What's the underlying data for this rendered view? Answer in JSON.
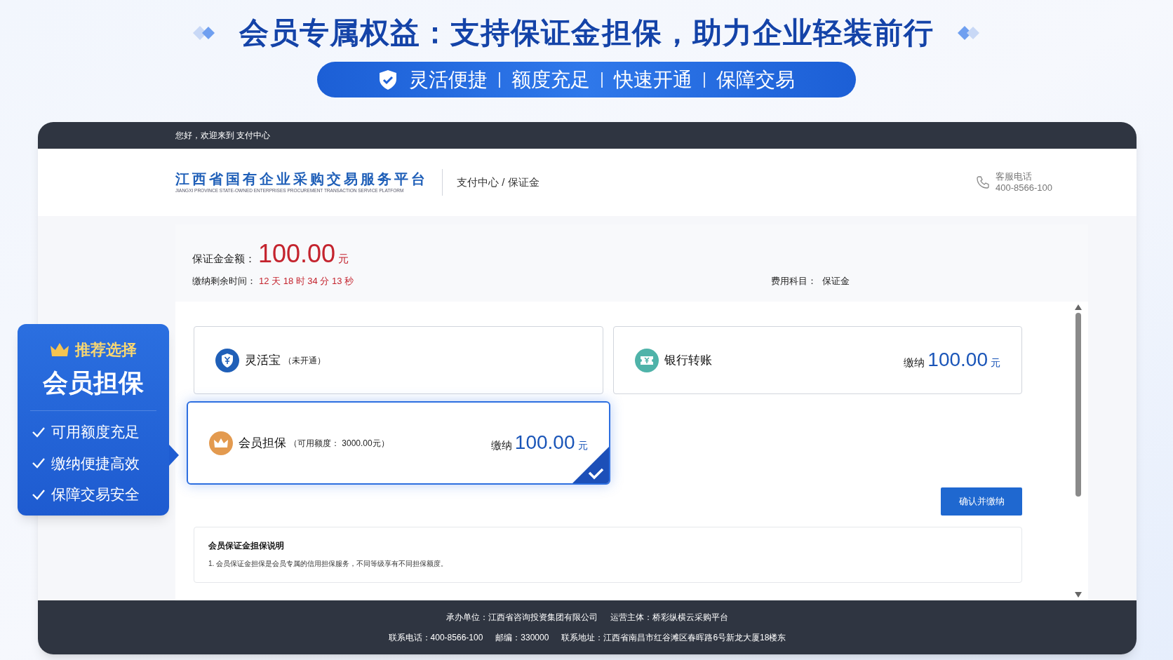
{
  "headline": "会员专属权益：支持保证金担保，助力企业轻装前行",
  "features": [
    "灵活便捷",
    "额度充足",
    "快速开通",
    "保障交易"
  ],
  "window": {
    "greeting": "您好，欢迎来到 支付中心",
    "platform_name": "江西省国有企业采购交易服务平台",
    "platform_english": "JIANGXI PROVINCE STATE-OWNED ENTERPRISES PROCUREMENT TRANSACTION SERVICE PLATFORM",
    "breadcrumb": "支付中心 / 保证金",
    "hotline_label": "客服电话",
    "hotline_number": "400-8566-100"
  },
  "payment": {
    "amount_label": "保证金金额：",
    "amount": "100.00",
    "unit": "元",
    "countdown_label": "缴纳剩余时间：",
    "countdown": "12 天 18 时 34 分 13 秒",
    "fee_label": "费用科目：",
    "fee_value": "保证金"
  },
  "options": [
    {
      "kind": "shield",
      "name": "灵活宝",
      "note": "（未开通）",
      "selected": false
    },
    {
      "kind": "ticket",
      "name": "银行转账",
      "pay_label": "缴纳",
      "amount": "100.00",
      "unit": "元",
      "selected": false
    },
    {
      "kind": "crown",
      "name": "会员担保",
      "note": "（可用额度： 3000.00元）",
      "pay_label": "缴纳",
      "amount": "100.00",
      "unit": "元",
      "selected": true
    }
  ],
  "confirm_button": "确认并缴纳",
  "notes": {
    "title": "会员保证金担保说明",
    "lines": [
      "1. 会员保证金担保是会员专属的信用担保服务，不同等级享有不同担保额度。"
    ]
  },
  "promo": {
    "tag": "推荐选择",
    "title": "会员担保",
    "points": [
      "可用额度充足",
      "缴纳便捷高效",
      "保障交易安全"
    ]
  },
  "footer": [
    [
      "承办单位：江西省咨询投资集团有限公司",
      "运营主体：桥彩纵横云采购平台"
    ],
    [
      "联系电话：400-8566-100",
      "邮编：330000",
      "联系地址：江西省南昌市红谷滩区春晖路6号新龙大厦18楼东"
    ]
  ]
}
